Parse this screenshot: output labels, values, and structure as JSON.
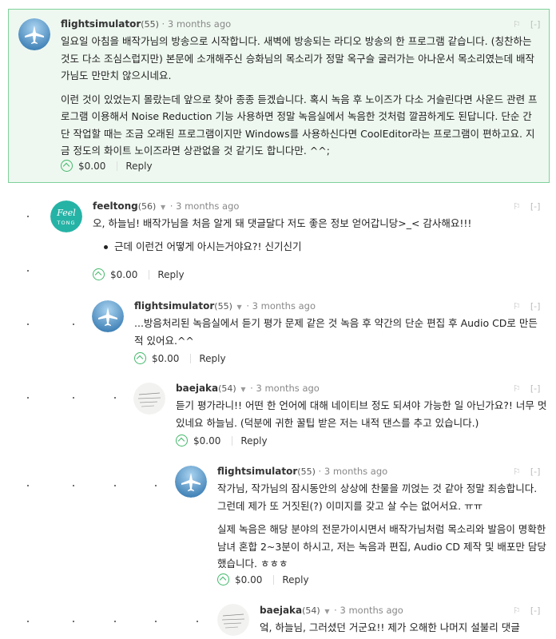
{
  "comments": [
    {
      "author": "flightsimulator",
      "rep": "(55)",
      "time": "3 months ago",
      "paragraphs": [
        "일요일 아침을 배작가님의 방송으로 시작합니다. 새벽에 방송되는 라디오 방송의 한 프로그램 같습니다. (칭찬하는 것도 다소 조심스럽지만) 본문에 소개해주신 승화님의 목소리가 정말 옥구슬 굴러가는 아나운서 목소리였는데 배작가님도 만만치 않으시네요.",
        "이런 것이 있었는지 몰랐는데 앞으로 찾아 종종 듣겠습니다. 혹시 녹음 후 노이즈가 다소 거슬린다면 사운드 관련 프로그램 이용해서 Noise Reduction 기능 사용하면 정말 녹음실에서 녹음한 것처럼 깔끔하게도 된답니다. 단순 간단 작업할 때는 조금 오래된 프로그램이지만 Windows를 사용하신다면 CoolEditor라는 프로그램이 편하고요. 지금 정도의 화이트 노이즈라면 상관없을 것 같기도 합니다만. ^^;"
      ],
      "amount": "$0.00",
      "reply": "Reply"
    },
    {
      "author": "feeltong",
      "rep": "(56)",
      "time": "3 months ago",
      "paragraphs": [
        "오, 하늘님! 배작가님을 처음 알게 돼 댓글달다 저도 좋은 정보 얻어갑니당>_< 감사해요!!!"
      ],
      "bullet": "근데 이런건 어떻게 아시는거야요?! 신기신기",
      "amount": "$0.00",
      "reply": "Reply",
      "avatar_text_top": "Feel",
      "avatar_text_bottom": "TONG"
    },
    {
      "author": "flightsimulator",
      "rep": "(55)",
      "time": "3 months ago",
      "paragraphs": [
        "...방음처리된 녹음실에서 듣기 평가 문제 같은 것 녹음 후 약간의 단순 편집 후 Audio CD로 만든 적 있어요.^^"
      ],
      "amount": "$0.00",
      "reply": "Reply"
    },
    {
      "author": "baejaka",
      "rep": "(54)",
      "time": "3 months ago",
      "paragraphs": [
        "듣기 평가라니!! 어떤 한 언어에 대해 네이티브 정도 되셔야 가능한 일 아닌가요?! 너무 멋있네요 하늘님. (덕분에 귀한 꿀팁 받은 저는 내적 댄스를 추고 있습니다.)"
      ],
      "amount": "$0.00",
      "reply": "Reply"
    },
    {
      "author": "flightsimulator",
      "rep": "(55)",
      "time": "3 months ago",
      "paragraphs": [
        "작가님, 작가님의 잠시동안의 상상에 찬물을 끼얹는 것 같아 정말 죄송합니다. 그런데 제가 또 거짓된(?) 이미지를 갖고 살 수는 없어서요. ㅠㅠ",
        "실제 녹음은 해당 분야의 전문가이시면서 배작가님처럼 목소리와 발음이 명확한 남녀 혼합 2~3분이 하시고, 저는 녹음과 편집, Audio CD 제작 및 배포만 담당했습니다. ㅎㅎㅎ"
      ],
      "amount": "$0.00",
      "reply": "Reply"
    },
    {
      "author": "baejaka",
      "rep": "(54)",
      "time": "3 months ago",
      "paragraphs": [
        "엌, 하늘님, 그러셨던 거군요!! 제가 오해한 나머지 설불리 댓글"
      ]
    }
  ],
  "flags": {
    "flag_icon": "flag-icon",
    "collapse": "[-]"
  },
  "colors": {
    "highlight_bg": "#eef8f0",
    "highlight_border": "#7fd19a",
    "accent": "#43b86b",
    "feeltong_bg": "#25b3a6"
  }
}
